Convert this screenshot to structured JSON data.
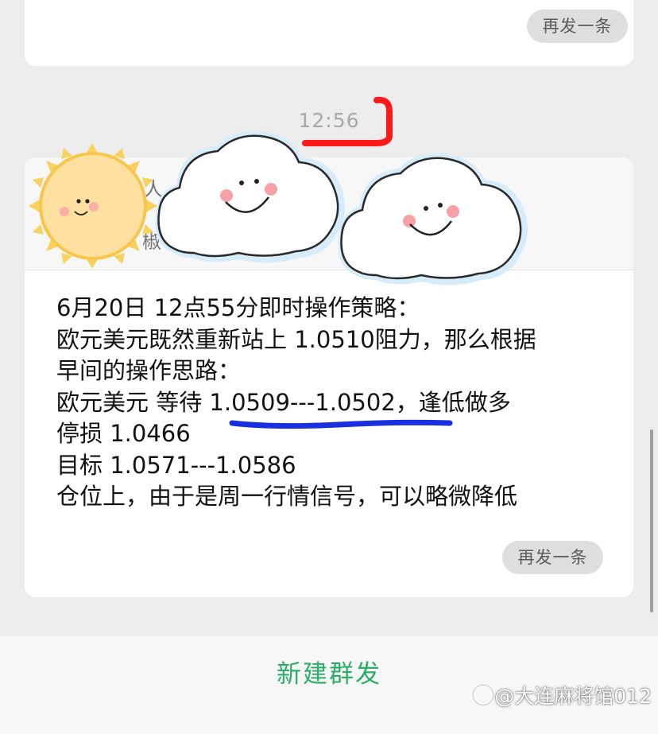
{
  "top_card": {
    "resend_label": "再发一条"
  },
  "timestamp": "12:56",
  "main_card": {
    "header_fragments": [
      "人",
      "椒"
    ],
    "message_lines": [
      "6月20日   12点55分即时操作策略：",
      "欧元美元既然重新站上 1.0510阻力，那么根据",
      "早间的操作思路：",
      "欧元美元 等待 1.0509---1.0502，逢低做多",
      "停损 1.0466",
      "目标 1.0571---1.0586",
      "仓位上，由于是周一行情信号，可以略微降低"
    ],
    "resend_label": "再发一条"
  },
  "bottom_bar": {
    "new_broadcast_label": "新建群发"
  },
  "watermark": "@大连麻将馆012",
  "colors": {
    "background": "#ededed",
    "card": "#ffffff",
    "accent_green": "#2aae67",
    "annotation_red": "#ff1a1a",
    "annotation_blue": "#1a2fe0"
  },
  "icons": {
    "watermark_logo": "zhihu-logo-icon",
    "sticker_sun": "sun-sticker-icon",
    "sticker_cloud": "cloud-sticker-icon"
  }
}
